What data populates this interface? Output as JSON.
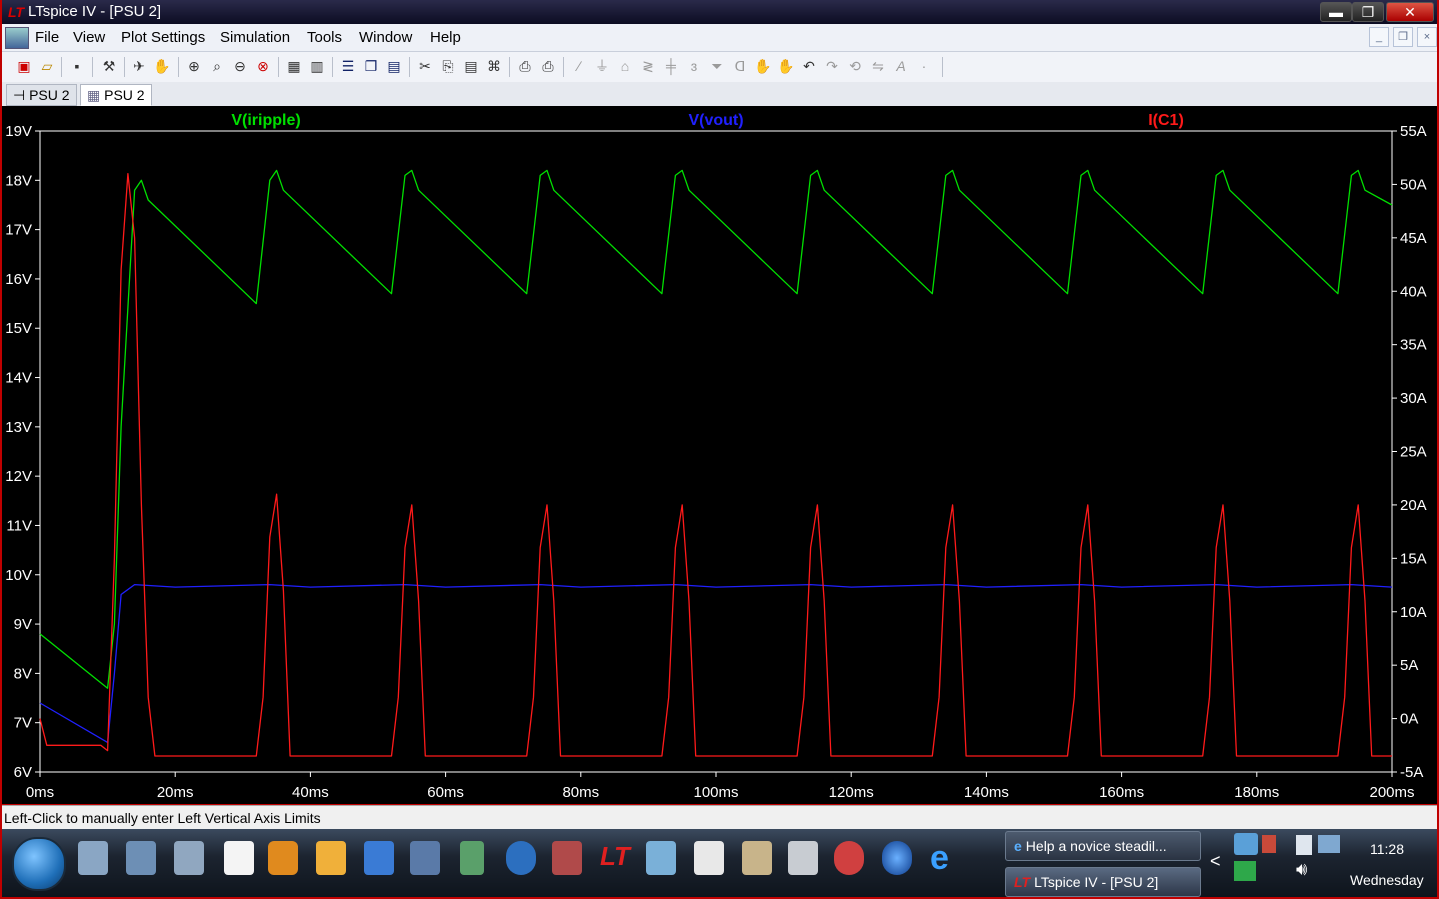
{
  "window": {
    "title": "LTspice IV - [PSU 2]",
    "controls": {
      "minimize": "▬",
      "restore": "❐",
      "close": "✕"
    }
  },
  "menubar": {
    "items": [
      "File",
      "View",
      "Plot Settings",
      "Simulation",
      "Tools",
      "Window",
      "Help"
    ],
    "mdi_controls": [
      "_",
      "❐",
      "×"
    ]
  },
  "toolbar": {
    "icons": [
      "new-schematic-icon",
      "open-icon",
      "save-icon",
      "control-panel-icon",
      "run-icon",
      "halt-icon",
      "zoom-in-icon",
      "zoom-area-icon",
      "zoom-out-icon",
      "zoom-cancel-icon",
      "autorange-icon",
      "add-trace-icon",
      "tile-horizontal-icon",
      "cascade-icon",
      "tile-vertical-icon",
      "cut-icon",
      "copy-icon",
      "paste-icon",
      "find-icon",
      "print-setup-icon",
      "print-icon",
      "wire-icon",
      "ground-icon",
      "label-icon",
      "resistor-icon",
      "capacitor-icon",
      "inductor-icon",
      "diode-icon",
      "component-icon",
      "move-icon",
      "drag-icon",
      "undo-icon",
      "redo-icon",
      "rotate-icon",
      "mirror-icon",
      "text-icon",
      "spice-directive-icon"
    ]
  },
  "tabs": [
    {
      "label": "PSU 2",
      "kind": "schematic",
      "active": false
    },
    {
      "label": "PSU 2",
      "kind": "waveform",
      "active": true
    }
  ],
  "plot": {
    "background": "#000000",
    "axis_color": "#ffffff",
    "traces": [
      {
        "name": "V(iripple)",
        "color": "#00e000"
      },
      {
        "name": "V(vout)",
        "color": "#2020ff"
      },
      {
        "name": "I(C1)",
        "color": "#ff1a1a"
      }
    ],
    "left_ticks": [
      "19V",
      "18V",
      "17V",
      "16V",
      "15V",
      "14V",
      "13V",
      "12V",
      "11V",
      "10V",
      "9V",
      "8V",
      "7V",
      "6V"
    ],
    "right_ticks": [
      "55A",
      "50A",
      "45A",
      "40A",
      "35A",
      "30A",
      "25A",
      "20A",
      "15A",
      "10A",
      "5A",
      "0A",
      "-5A"
    ],
    "x_ticks": [
      "0ms",
      "20ms",
      "40ms",
      "60ms",
      "80ms",
      "100ms",
      "120ms",
      "140ms",
      "160ms",
      "180ms",
      "200ms"
    ]
  },
  "chart_data": {
    "type": "line",
    "xlabel": "",
    "ylabel": "",
    "x_unit": "ms",
    "xlim": [
      0,
      200
    ],
    "ylim_left": [
      6,
      19
    ],
    "ylim_right": [
      -5,
      55
    ],
    "grid": false,
    "series": [
      {
        "name": "V(iripple)",
        "axis": "left",
        "x": [
          0,
          10,
          11,
          12,
          14,
          15,
          16,
          32,
          34,
          35,
          36,
          52,
          54,
          55,
          56,
          72,
          74,
          75,
          76,
          92,
          94,
          95,
          96,
          112,
          114,
          115,
          116,
          132,
          134,
          135,
          136,
          152,
          154,
          155,
          156,
          172,
          174,
          175,
          176,
          192,
          194,
          195,
          196,
          200
        ],
        "y": [
          8.8,
          7.7,
          9,
          13,
          17.8,
          18,
          17.6,
          15.5,
          18,
          18.2,
          17.8,
          15.7,
          18.1,
          18.2,
          17.8,
          15.7,
          18.1,
          18.2,
          17.8,
          15.7,
          18.1,
          18.2,
          17.8,
          15.7,
          18.1,
          18.2,
          17.8,
          15.7,
          18.1,
          18.2,
          17.8,
          15.7,
          18.1,
          18.2,
          17.8,
          15.7,
          18.1,
          18.2,
          17.8,
          15.7,
          18.1,
          18.2,
          17.8,
          17.5
        ]
      },
      {
        "name": "V(vout)",
        "axis": "left",
        "x": [
          0,
          10,
          11,
          12,
          14,
          20,
          34,
          40,
          54,
          60,
          74,
          80,
          94,
          100,
          114,
          120,
          134,
          140,
          154,
          160,
          174,
          180,
          194,
          200
        ],
        "y": [
          7.4,
          6.6,
          8,
          9.6,
          9.8,
          9.75,
          9.8,
          9.75,
          9.8,
          9.75,
          9.8,
          9.75,
          9.8,
          9.75,
          9.8,
          9.75,
          9.8,
          9.75,
          9.8,
          9.75,
          9.8,
          9.75,
          9.8,
          9.75
        ]
      },
      {
        "name": "I(C1)",
        "axis": "right",
        "x": [
          0,
          1,
          9,
          10,
          11,
          12,
          13,
          14,
          15,
          16,
          17,
          32,
          33,
          34,
          35,
          36,
          37,
          52,
          53,
          54,
          55,
          56,
          57,
          72,
          73,
          74,
          75,
          76,
          77,
          92,
          93,
          94,
          95,
          96,
          97,
          112,
          113,
          114,
          115,
          116,
          117,
          132,
          133,
          134,
          135,
          136,
          137,
          152,
          153,
          154,
          155,
          156,
          157,
          172,
          173,
          174,
          175,
          176,
          177,
          192,
          193,
          194,
          195,
          196,
          197,
          200
        ],
        "y": [
          0,
          -2.5,
          -2.5,
          -3,
          15,
          42,
          51,
          45,
          20,
          2,
          -3.5,
          -3.5,
          2,
          17,
          21,
          12,
          -3.5,
          -3.5,
          2,
          16,
          20,
          11,
          -3.5,
          -3.5,
          2,
          16,
          20,
          11,
          -3.5,
          -3.5,
          2,
          16,
          20,
          11,
          -3.5,
          -3.5,
          2,
          16,
          20,
          11,
          -3.5,
          -3.5,
          2,
          16,
          20,
          11,
          -3.5,
          -3.5,
          2,
          16,
          20,
          11,
          -3.5,
          -3.5,
          2,
          16,
          20,
          11,
          -3.5,
          -3.5,
          2,
          16,
          20,
          11,
          -3.5,
          -3.5
        ]
      }
    ]
  },
  "statusbar": {
    "text": "Left-Click to manually enter Left Vertical Axis Limits"
  },
  "taskbar": {
    "pinned": [
      "explorer-icon",
      "media-icon",
      "documents-icon",
      "blank-doc-icon",
      "media-player-icon",
      "paint-icon",
      "screen-icon",
      "monitor-icon",
      "trophy-icon",
      "office-2010-icon",
      "networking-icon",
      "ltspice-icon",
      "notepad-icon",
      "wordpad-icon",
      "tools-icon",
      "calculator-icon",
      "snipping-icon",
      "earth-icon",
      "ie-icon"
    ],
    "tasks": [
      {
        "label": "Help a novice steadil...",
        "icon": "ie-icon"
      },
      {
        "label": "LTspice IV - [PSU 2]",
        "icon": "ltspice-icon"
      }
    ],
    "tray_chevron": "<",
    "clock_time": "11:28",
    "clock_day": "Wednesday"
  }
}
